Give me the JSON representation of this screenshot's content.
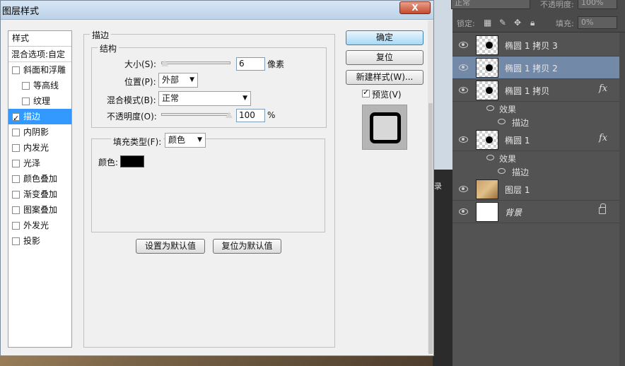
{
  "dialog": {
    "title": "图层样式",
    "close_label": "X",
    "styles_header": "样式",
    "blend_options": "混合选项:自定",
    "style_items": [
      {
        "label": "斜面和浮雕",
        "checked": false,
        "indent": false
      },
      {
        "label": "等高线",
        "checked": false,
        "indent": true
      },
      {
        "label": "纹理",
        "checked": false,
        "indent": true
      },
      {
        "label": "描边",
        "checked": true,
        "indent": false,
        "active": true
      },
      {
        "label": "内阴影",
        "checked": false,
        "indent": false
      },
      {
        "label": "内发光",
        "checked": false,
        "indent": false
      },
      {
        "label": "光泽",
        "checked": false,
        "indent": false
      },
      {
        "label": "颜色叠加",
        "checked": false,
        "indent": false
      },
      {
        "label": "渐变叠加",
        "checked": false,
        "indent": false
      },
      {
        "label": "图案叠加",
        "checked": false,
        "indent": false
      },
      {
        "label": "外发光",
        "checked": false,
        "indent": false
      },
      {
        "label": "投影",
        "checked": false,
        "indent": false
      }
    ],
    "stroke": {
      "group_title": "描边",
      "structure_title": "结构",
      "size_label": "大小(S):",
      "size_value": "6",
      "size_unit": "像素",
      "position_label": "位置(P):",
      "position_value": "外部",
      "blend_mode_label": "混合模式(B):",
      "blend_mode_value": "正常",
      "opacity_label": "不透明度(O):",
      "opacity_value": "100",
      "opacity_unit": "%",
      "fill_type_label": "填充类型(F):",
      "fill_type_value": "颜色",
      "color_label": "颜色:",
      "color_value": "#000000"
    },
    "buttons": {
      "ok": "确定",
      "reset": "复位",
      "new_style": "新建样式(W)...",
      "preview": "预览(V)",
      "preview_checked": true,
      "set_default": "设置为默认值",
      "reset_default": "复位为默认值"
    }
  },
  "layers_panel": {
    "blend_mode": "正常",
    "opacity_label": "不透明度:",
    "opacity_value": "100%",
    "lock_label": "锁定:",
    "fill_label": "填充:",
    "fill_value": "0%",
    "layers": [
      {
        "name": "椭圆 1 拷贝 3",
        "fx": false,
        "selected": false
      },
      {
        "name": "椭圆 1 拷贝 2",
        "fx": false,
        "selected": true
      },
      {
        "name": "椭圆 1 拷贝",
        "fx": true,
        "selected": false,
        "effects": "效果",
        "stroke": "描边"
      },
      {
        "name": "椭圆 1",
        "fx": true,
        "selected": false,
        "effects": "效果",
        "stroke": "描边"
      },
      {
        "name": "图层 1",
        "fx": false,
        "selected": false
      },
      {
        "name": "背景",
        "fx": false,
        "selected": false,
        "locked": true
      }
    ],
    "fx_label": "fx"
  },
  "side_strip": {
    "tab_label": "录"
  }
}
